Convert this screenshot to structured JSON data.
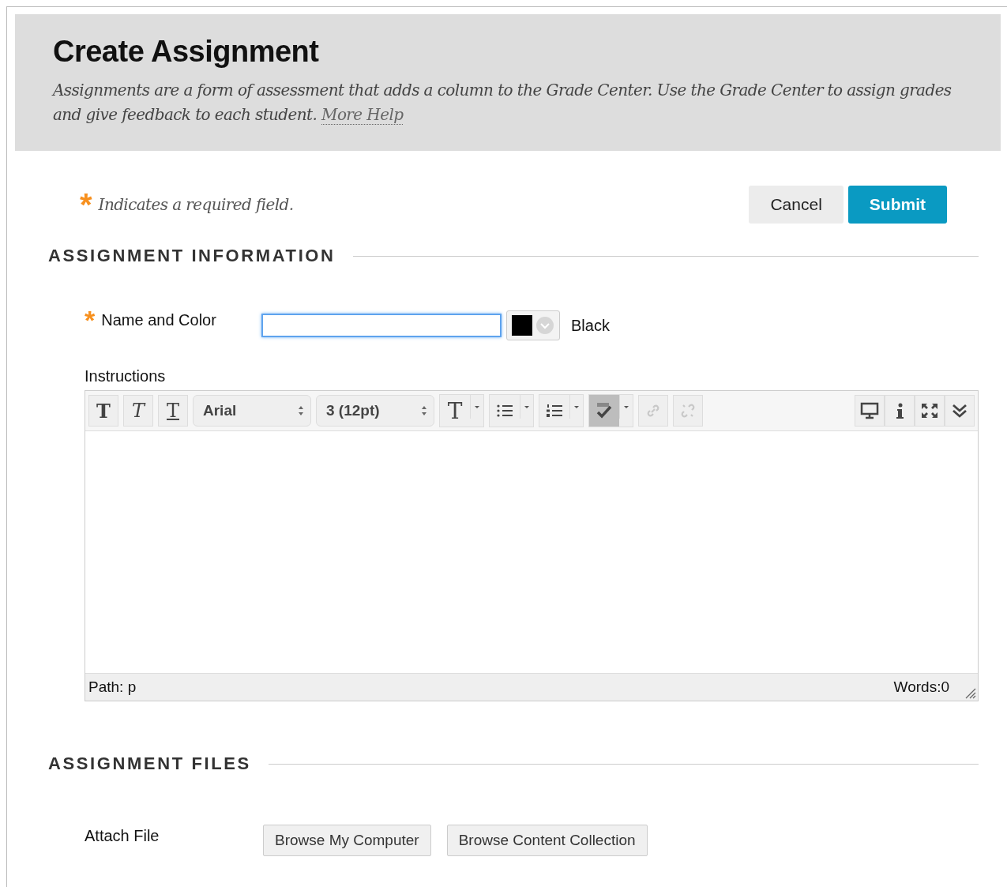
{
  "header": {
    "title": "Create Assignment",
    "description": "Assignments are a form of assessment that adds a column to the Grade Center. Use the Grade Center to assign grades and give feedback to each student.",
    "help_link": "More Help"
  },
  "required_note": {
    "mark": "*",
    "text": "Indicates a required field."
  },
  "buttons": [
    {
      "label": "Cancel",
      "kind": "secondary"
    },
    {
      "label": "Submit",
      "kind": "primary"
    }
  ],
  "sections": [
    {
      "title": "ASSIGNMENT INFORMATION"
    },
    {
      "title": "ASSIGNMENT FILES"
    }
  ],
  "name_field": {
    "required_mark": "*",
    "label": "Name and Color",
    "focused": true,
    "color": "#000000",
    "color_name": "Black"
  },
  "instructions": {
    "label": "Instructions",
    "toolbar_left": [
      {
        "kind": "format",
        "glyph": "T"
      },
      {
        "kind": "format",
        "glyph": "T"
      },
      {
        "kind": "format",
        "glyph": "T"
      },
      {
        "kind": "select",
        "value": "Arial"
      },
      {
        "kind": "select",
        "value": "3 (12pt)"
      },
      {
        "kind": "textcolor",
        "glyph": "T"
      },
      {
        "kind": "bullets"
      },
      {
        "kind": "numbers"
      },
      {
        "kind": "spellcheck",
        "active": true
      },
      {
        "kind": "link",
        "disabled": true
      },
      {
        "kind": "unlink",
        "disabled": true
      }
    ],
    "toolbar_right": [
      {
        "kind": "preview"
      },
      {
        "kind": "info"
      },
      {
        "kind": "fullscreen"
      },
      {
        "kind": "collapse"
      }
    ],
    "path": "Path: p",
    "words": "Words:0"
  },
  "attach": {
    "label": "Attach File",
    "buttons": [
      "Browse My Computer",
      "Browse Content Collection"
    ]
  }
}
